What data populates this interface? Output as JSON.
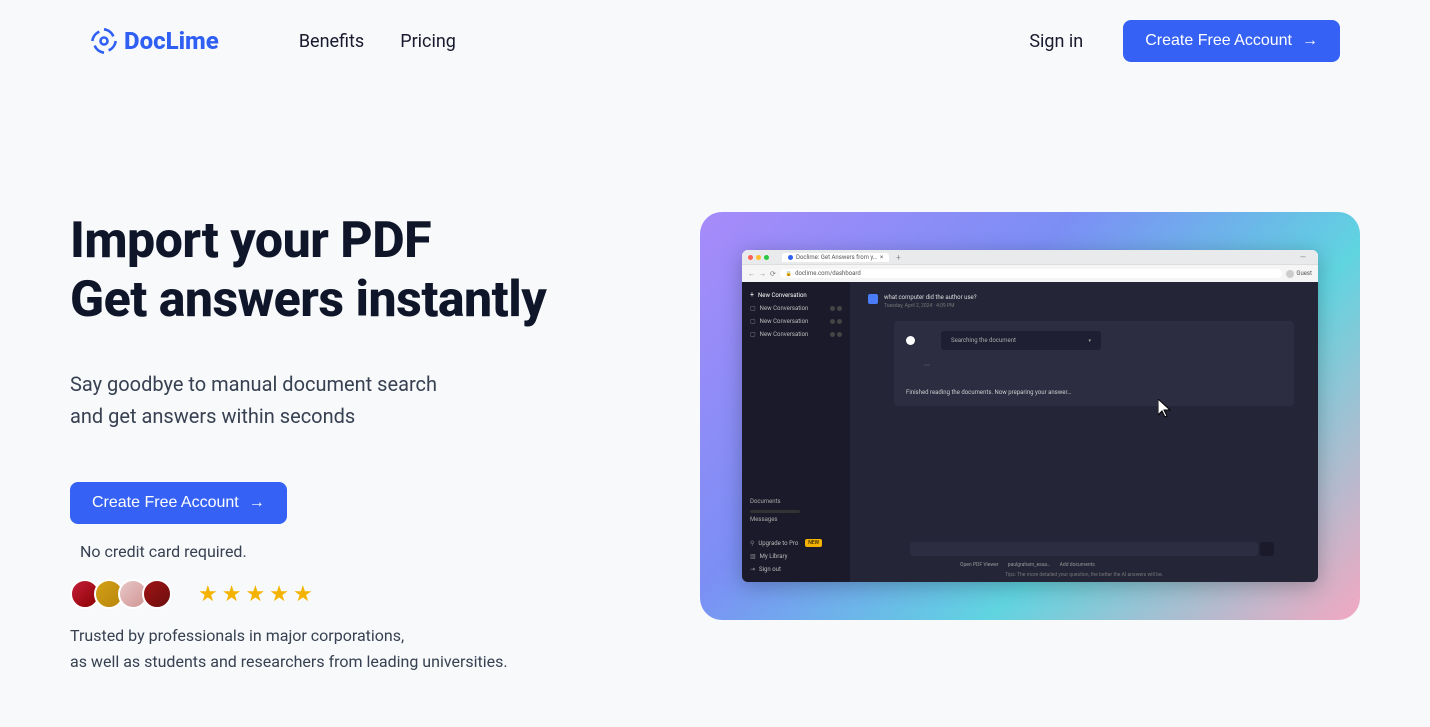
{
  "brand": "DocLime",
  "nav": {
    "benefits": "Benefits",
    "pricing": "Pricing",
    "signin": "Sign in",
    "cta": "Create Free Account"
  },
  "hero": {
    "title_line1": "Import your PDF",
    "title_line2": "Get answers instantly",
    "sub_line1": "Say goodbye to manual document search",
    "sub_line2": "and get answers within seconds",
    "cta": "Create Free Account",
    "no_cc": "No credit card required.",
    "trust_line1": "Trusted by professionals in major corporations,",
    "trust_line2": "as well as students and researchers from leading universities."
  },
  "demo": {
    "tab_title": "Doclime: Get Answers from y…",
    "url": "doclime.com/dashboard",
    "guest": "Guest",
    "sidebar": {
      "new_conv": "New Conversation",
      "conv_item": "New Conversation",
      "documents": "Documents",
      "messages": "Messages",
      "upgrade": "Upgrade to Pro",
      "new_badge": "NEW",
      "library": "My Library",
      "signout": "Sign out"
    },
    "chat": {
      "question": "what computer did the author use?",
      "timestamp": "Tuesday, April 2, 2024 · 4:09 PM",
      "searching": "Searching the document",
      "finished": "Finished reading the documents. Now preparing your answer…"
    },
    "footer": {
      "open_pdf": "Open PDF Viewer",
      "docname": "paulgraham_essa…",
      "add_docs": "Add documents",
      "tip": "Tips: The more detailed your question, the better the AI answers will be."
    }
  }
}
